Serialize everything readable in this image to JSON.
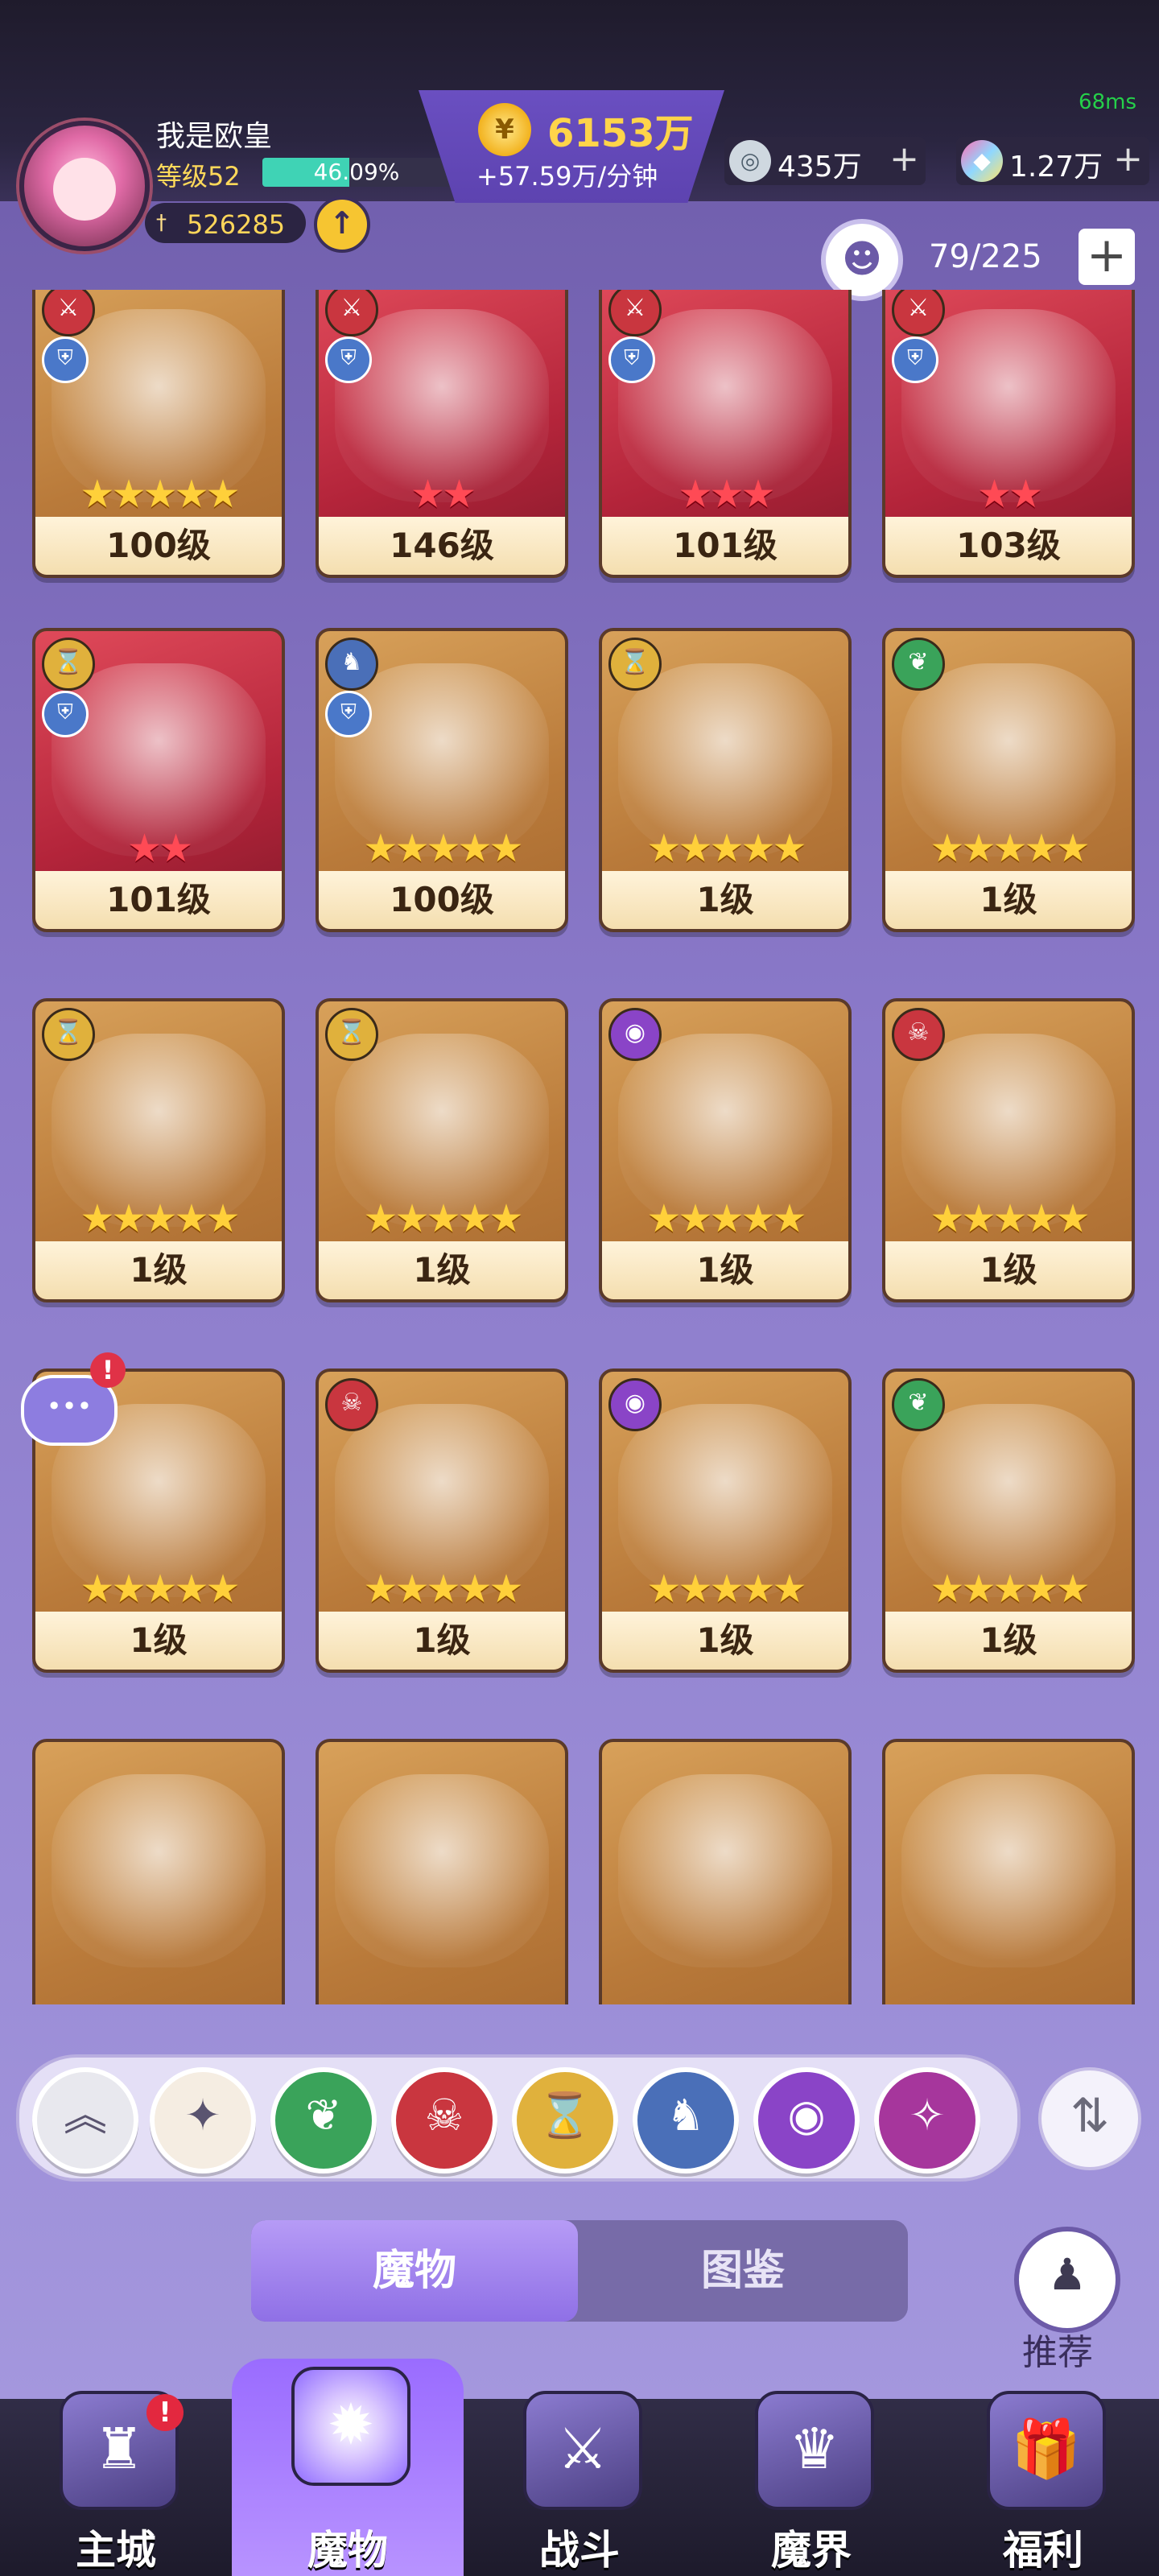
{
  "status": {
    "fps": "68ms"
  },
  "player": {
    "name": "我是欧皇",
    "level": "等级52",
    "exp_percent_text": "46.09%",
    "exp_fraction": 0.4609,
    "power": "526285",
    "power_up_icon": "up-arrow-icon"
  },
  "currency": {
    "gold": "6153万",
    "gold_rate": "+57.59万/分钟",
    "gold_icon_glyph": "¥",
    "silver": "435万",
    "gems": "1.27万",
    "plus_glyph": "+"
  },
  "inventory": {
    "count": "79/225",
    "add_glyph": "+"
  },
  "cards": [
    {
      "level": "100级",
      "stars": "★★★★★",
      "star_color": "gold",
      "bg": "gold"
    },
    {
      "level": "146级",
      "stars": "★★",
      "star_color": "red",
      "bg": "red"
    },
    {
      "level": "101级",
      "stars": "★★★",
      "star_color": "red",
      "bg": "red"
    },
    {
      "level": "103级",
      "stars": "★★",
      "star_color": "red",
      "bg": "red"
    },
    {
      "level": "101级",
      "stars": "★★",
      "star_color": "red",
      "bg": "red"
    },
    {
      "level": "100级",
      "stars": "★★★★★",
      "star_color": "gold",
      "bg": "gold"
    },
    {
      "level": "1级",
      "stars": "★★★★★",
      "star_color": "gold",
      "bg": "gold"
    },
    {
      "level": "1级",
      "stars": "★★★★★",
      "star_color": "gold",
      "bg": "gold"
    },
    {
      "level": "1级",
      "stars": "★★★★★",
      "star_color": "gold",
      "bg": "gold"
    },
    {
      "level": "1级",
      "stars": "★★★★★",
      "star_color": "gold",
      "bg": "gold"
    },
    {
      "level": "1级",
      "stars": "★★★★★",
      "star_color": "gold",
      "bg": "gold"
    },
    {
      "level": "1级",
      "stars": "★★★★★",
      "star_color": "gold",
      "bg": "gold"
    },
    {
      "level": "1级",
      "stars": "★★★★★",
      "star_color": "gold",
      "bg": "gold"
    },
    {
      "level": "1级",
      "stars": "★★★★★",
      "star_color": "gold",
      "bg": "gold"
    },
    {
      "level": "1级",
      "stars": "★★★★★",
      "star_color": "gold",
      "bg": "gold"
    },
    {
      "level": "1级",
      "stars": "★★★★★",
      "star_color": "gold",
      "bg": "gold"
    }
  ],
  "filters": [
    {
      "name": "collapse",
      "glyph": "︽",
      "color": "#e8e8ee"
    },
    {
      "name": "all",
      "glyph": "✦",
      "color": "#f5ede2"
    },
    {
      "name": "nature",
      "glyph": "❦",
      "color": "#3aa35a"
    },
    {
      "name": "demon",
      "glyph": "☠",
      "color": "#c9363f"
    },
    {
      "name": "time",
      "glyph": "⌛",
      "color": "#e0b13c"
    },
    {
      "name": "dragon",
      "glyph": "♞",
      "color": "#4a6fb8"
    },
    {
      "name": "eye",
      "glyph": "◉",
      "color": "#8a44c7"
    },
    {
      "name": "arcane",
      "glyph": "✧",
      "color": "#a6369c"
    }
  ],
  "tabs": {
    "left": "魔物",
    "right": "图鉴"
  },
  "recommend_label": "推荐",
  "nav": [
    {
      "label": "主城",
      "glyph": "♜"
    },
    {
      "label": "魔物",
      "glyph": "✹"
    },
    {
      "label": "战斗",
      "glyph": "⚔"
    },
    {
      "label": "魔界",
      "glyph": "♛"
    },
    {
      "label": "福利",
      "glyph": "🎁"
    }
  ]
}
